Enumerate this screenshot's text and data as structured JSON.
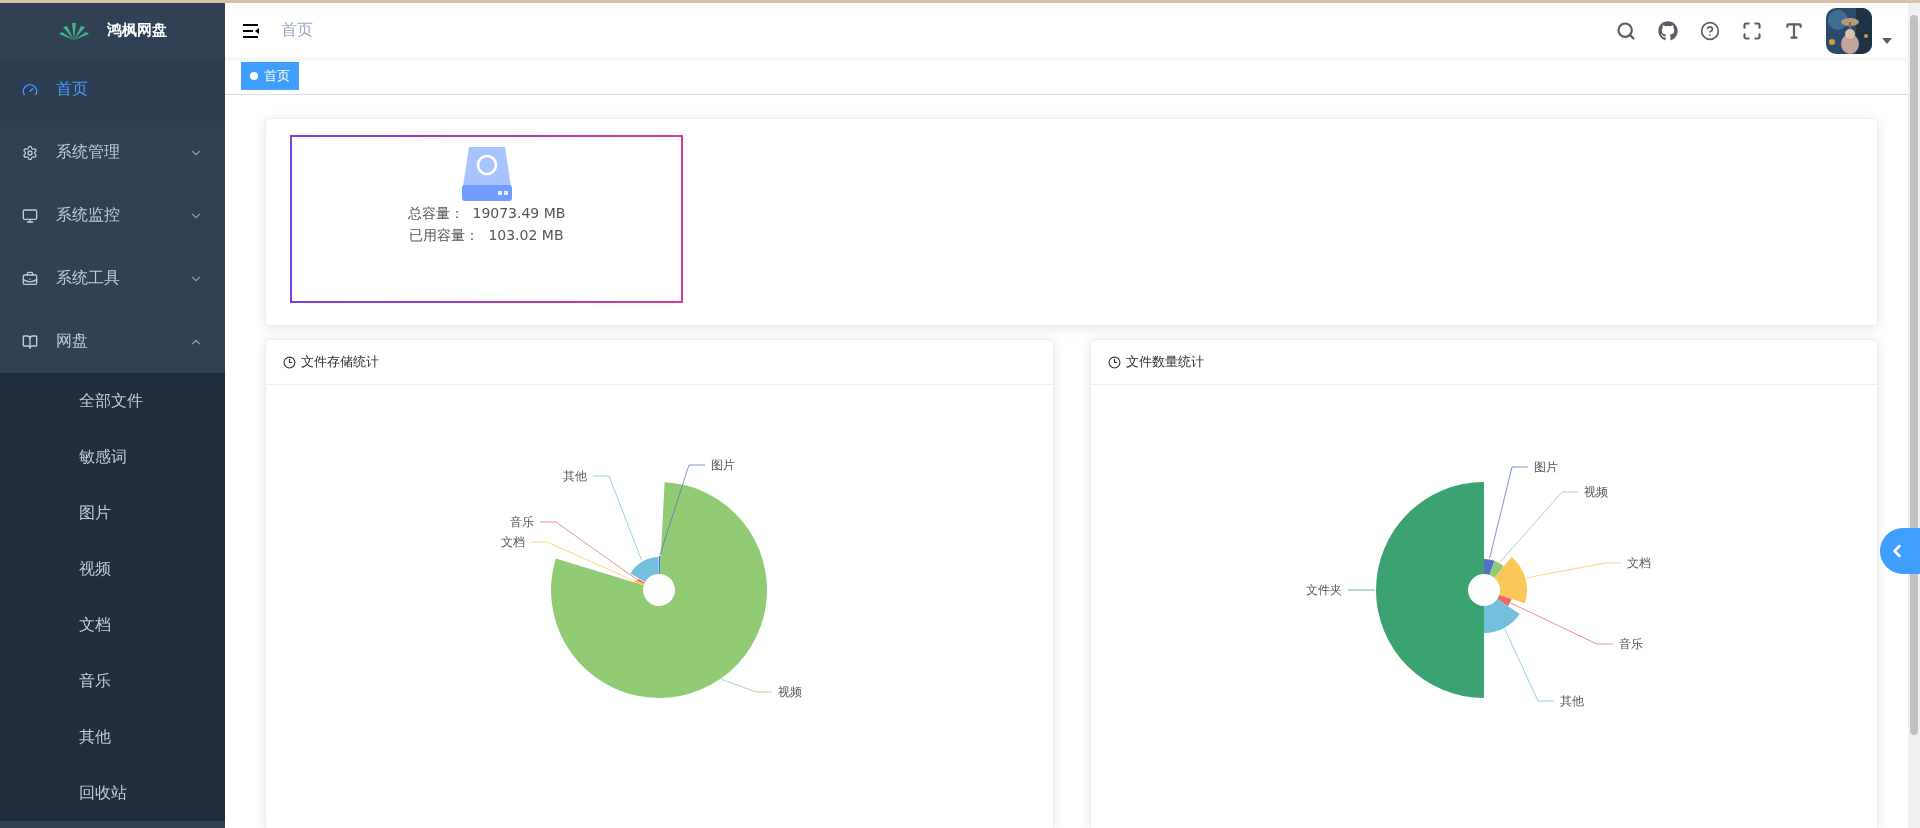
{
  "sidebar": {
    "logo_text": "鸿枫网盘",
    "items": [
      {
        "label": "首页",
        "selected": true
      },
      {
        "label": "系统管理",
        "selected": false,
        "expanded": false
      },
      {
        "label": "系统监控",
        "selected": false,
        "expanded": false
      },
      {
        "label": "系统工具",
        "selected": false,
        "expanded": false
      },
      {
        "label": "网盘",
        "selected": false,
        "expanded": true,
        "children": [
          {
            "label": "全部文件",
            "selected": false
          },
          {
            "label": "敏感词",
            "selected": false
          },
          {
            "label": "图片",
            "selected": false
          },
          {
            "label": "视频",
            "selected": false
          },
          {
            "label": "文档",
            "selected": false
          },
          {
            "label": "音乐",
            "selected": false
          },
          {
            "label": "其他",
            "selected": false
          },
          {
            "label": "回收站",
            "selected": false
          }
        ]
      }
    ]
  },
  "header": {
    "breadcrumb": "首页"
  },
  "tags": [
    {
      "label": "首页",
      "selected": true
    }
  ],
  "disk": {
    "rows": [
      {
        "label": "总容量：",
        "value": "19073.49 MB"
      },
      {
        "label": "已用容量：",
        "value": "103.02 MB"
      }
    ]
  },
  "charts": [
    {
      "title": "文件存储统计",
      "slices": [
        {
          "label": "图片",
          "color": "#5470c6"
        },
        {
          "label": "视频",
          "color": "#91cc75"
        },
        {
          "label": "文档",
          "color": "#fac858"
        },
        {
          "label": "音乐",
          "color": "#ee6666"
        },
        {
          "label": "其他",
          "color": "#73c0de"
        }
      ]
    },
    {
      "title": "文件数量统计",
      "slices": [
        {
          "label": "图片",
          "color": "#5470c6"
        },
        {
          "label": "视频",
          "color": "#91cc75"
        },
        {
          "label": "文档",
          "color": "#fac858"
        },
        {
          "label": "音乐",
          "color": "#ee6666"
        },
        {
          "label": "其他",
          "color": "#73c0de"
        },
        {
          "label": "文件夹",
          "color": "#3ba272"
        }
      ]
    }
  ]
}
